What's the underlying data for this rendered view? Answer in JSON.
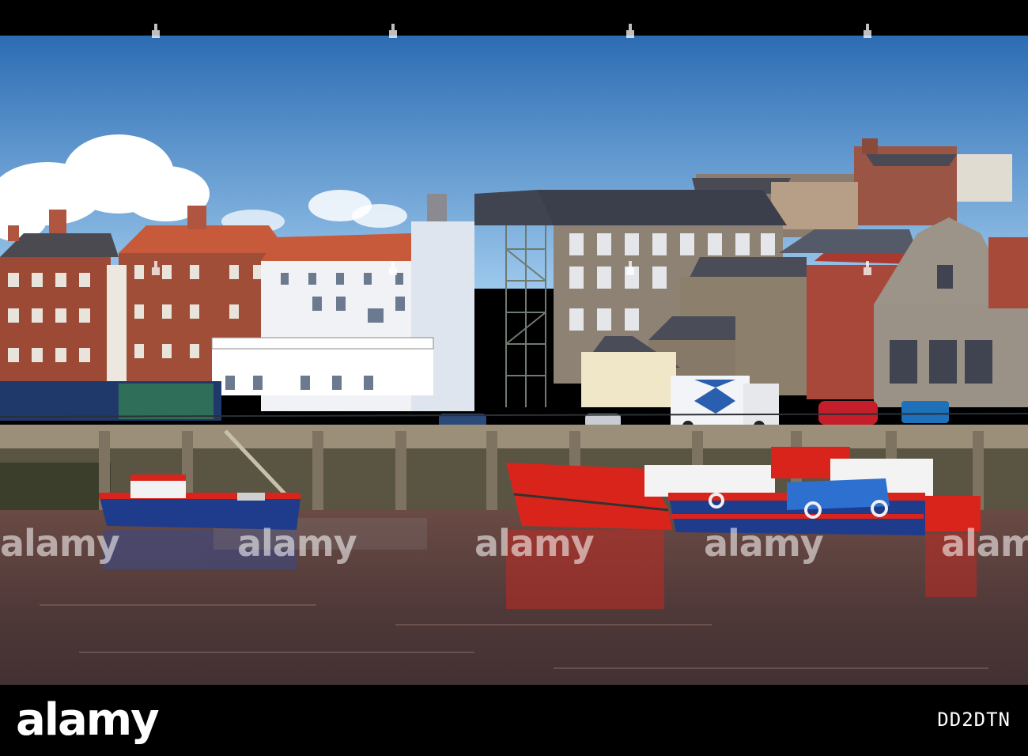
{
  "watermark": {
    "text": "alamy"
  },
  "footer": {
    "brand": "alamy",
    "image_id": "DD2DTN"
  },
  "colors": {
    "sky_top": "#2f6fb5",
    "sky_bottom": "#8fc0e8",
    "brick": "#9c4a35",
    "roof": "#c85a3c",
    "water": "#5a3a3a",
    "boat_red": "#d9241c",
    "boat_blue": "#1f3c8c"
  }
}
